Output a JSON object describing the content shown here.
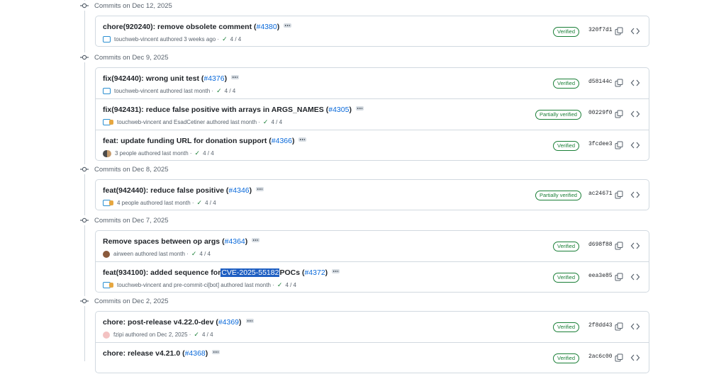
{
  "colors": {
    "verified": "#1a7f37",
    "link": "#0969da",
    "highlight": "#1f5fc2"
  },
  "groups": [
    {
      "date_label": "Commits on Dec 12, 2025",
      "commits": [
        {
          "title": "chore(920240): remove obsolete comment (",
          "pr": "#4380",
          "close": ")",
          "authors": "touchweb-vincent",
          "authored": "authored 3 weeks ago",
          "checks": "4 / 4",
          "badge": "Verified",
          "sha": "320f7d1",
          "avatar": "square-icon"
        }
      ]
    },
    {
      "date_label": "Commits on Dec 9, 2025",
      "commits": [
        {
          "title": "fix(942440): wrong unit test (",
          "pr": "#4376",
          "close": ")",
          "authors": "touchweb-vincent",
          "authored": "authored last month",
          "checks": "4 / 4",
          "badge": "Verified",
          "sha": "d58144c",
          "avatar": "square-icon"
        },
        {
          "title": "fix(942431): reduce false positive with arrays in ARGS_NAMES (",
          "pr": "#4305",
          "close": ")",
          "authors": "touchweb-vincent and EsadCetiner",
          "authored": "authored last month",
          "checks": "4 / 4",
          "badge": "Partially verified",
          "sha": "00229f0",
          "avatar": "multi-avatar-icon"
        },
        {
          "title": "feat: update funding URL for donation support (",
          "pr": "#4366",
          "close": ")",
          "authors": "3 people",
          "authored": "authored last month",
          "checks": "4 / 4",
          "badge": "Verified",
          "sha": "3fcdee3",
          "avatar": "people-icon"
        }
      ]
    },
    {
      "date_label": "Commits on Dec 8, 2025",
      "commits": [
        {
          "title": "feat(942440): reduce false positive (",
          "pr": "#4346",
          "close": ")",
          "authors": "4 people",
          "authored": "authored last month",
          "checks": "4 / 4",
          "badge": "Partially verified",
          "sha": "ac24671",
          "avatar": "multi-avatar-icon"
        }
      ]
    },
    {
      "date_label": "Commits on Dec 7, 2025",
      "commits": [
        {
          "title": "Remove spaces between op args (",
          "pr": "#4364",
          "close": ")",
          "authors": "airween",
          "authored": "authored last month",
          "checks": "4 / 4",
          "badge": "Verified",
          "sha": "d698f88",
          "avatar": "photo-icon"
        },
        {
          "title": "feat(934100): added sequence for ",
          "highlight": "CVE-2025-55182",
          "title_rest": " POCs (",
          "pr": "#4372",
          "close": ")",
          "authors": "touchweb-vincent and pre-commit-ci[bot]",
          "authored": "authored last month",
          "checks": "4 / 4",
          "badge": "Verified",
          "sha": "eea3e85",
          "avatar": "multi-avatar-icon"
        }
      ]
    },
    {
      "date_label": "Commits on Dec 2, 2025",
      "commits": [
        {
          "title": "chore: post-release v4.22.0-dev (",
          "pr": "#4369",
          "close": ")",
          "authors": "fzipi",
          "authored": "authored on Dec 2, 2025",
          "checks": "4 / 4",
          "badge": "Verified",
          "sha": "2f8dd43",
          "avatar": "pink-icon"
        },
        {
          "title": "chore: release v4.21.0 (",
          "pr": "#4368",
          "close": ")",
          "authors": "",
          "authored": "",
          "checks": "",
          "badge": "Verified",
          "sha": "2ac6c00",
          "avatar": ""
        }
      ]
    }
  ]
}
